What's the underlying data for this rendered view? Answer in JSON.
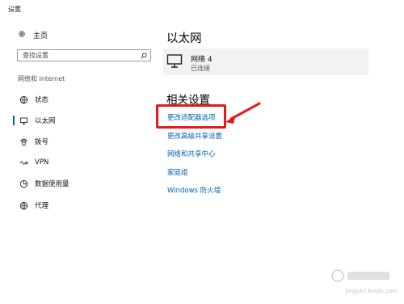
{
  "window": {
    "title": "设置"
  },
  "sidebar": {
    "home_label": "主页",
    "search_placeholder": "查找设置",
    "section_heading": "网络和 Internet",
    "items": [
      {
        "label": "状态",
        "icon": "globe-status-icon",
        "selected": false
      },
      {
        "label": "以太网",
        "icon": "ethernet-monitor-icon",
        "selected": true
      },
      {
        "label": "拨号",
        "icon": "phone-dialup-icon",
        "selected": false
      },
      {
        "label": "VPN",
        "icon": "vpn-icon",
        "selected": false
      },
      {
        "label": "数据使用量",
        "icon": "data-usage-icon",
        "selected": false
      },
      {
        "label": "代理",
        "icon": "globe-proxy-icon",
        "selected": false
      }
    ]
  },
  "main": {
    "title": "以太网",
    "network": {
      "name": "网络  4",
      "status": "已连接",
      "icon": "network-monitor-icon"
    },
    "related_title": "相关设置",
    "links": [
      "更改适配器选项",
      "更改高级共享设置",
      "网络和共享中心",
      "家庭组",
      "Windows 防火墙"
    ]
  },
  "colors": {
    "accent": "#0063b1",
    "annotation": "#e21b1b",
    "card_bg": "#f2f2f2"
  },
  "watermark": {
    "text": "jingyan.baidu.com"
  }
}
